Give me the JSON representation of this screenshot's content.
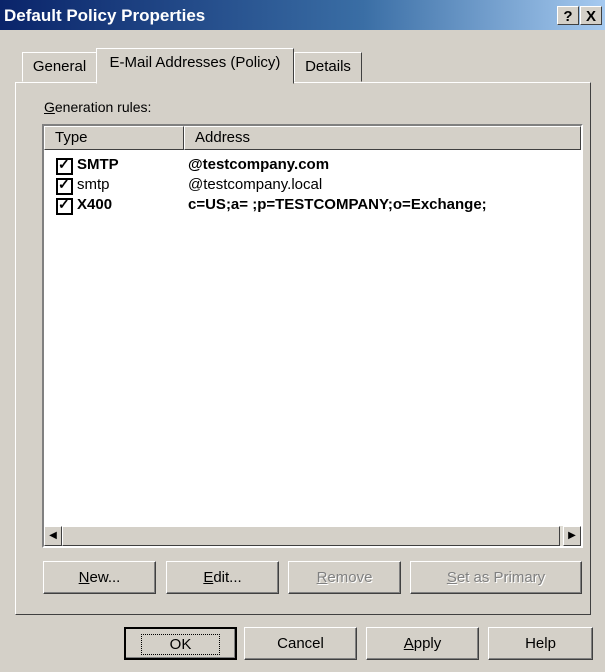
{
  "window": {
    "title": "Default Policy Properties"
  },
  "title_buttons": {
    "help": "?",
    "close": "X"
  },
  "tabs": [
    {
      "label": "General"
    },
    {
      "label": "E-Mail Addresses (Policy)"
    },
    {
      "label": "Details"
    }
  ],
  "generation_rules": {
    "label_first": "G",
    "label_rest": "eneration rules:",
    "columns": [
      "Type",
      "Address"
    ],
    "rows": [
      {
        "type": "SMTP",
        "address": "@testcompany.com",
        "checked": true,
        "bold": true
      },
      {
        "type": "smtp",
        "address": "@testcompany.local",
        "checked": true,
        "bold": false
      },
      {
        "type": "X400",
        "address": "c=US;a= ;p=TESTCOMPANY;o=Exchange;",
        "checked": true,
        "bold": true
      }
    ]
  },
  "list_buttons": {
    "new_first": "N",
    "new_rest": "ew...",
    "edit_first": "E",
    "edit_rest": "dit...",
    "remove_first": "R",
    "remove_rest": "emove",
    "primary_first": "S",
    "primary_rest": "et as Primary"
  },
  "dialog_buttons": {
    "ok": "OK",
    "cancel": "Cancel",
    "apply_first": "A",
    "apply_rest": "pply",
    "help": "Help"
  },
  "icons": {
    "scroll_left": "arrow-left-icon",
    "scroll_right": "arrow-right-icon"
  }
}
